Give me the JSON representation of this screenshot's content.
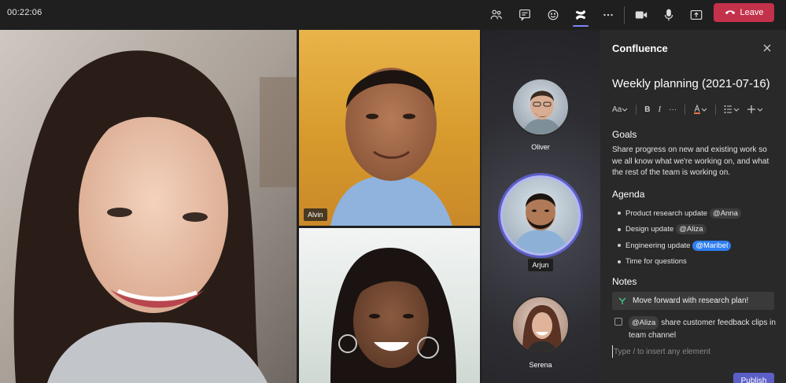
{
  "topbar": {
    "timer": "00:22:06",
    "leave_label": "Leave",
    "icons": [
      "people-icon",
      "chat-icon",
      "reactions-icon",
      "confluence-app-icon",
      "more-icon",
      "camera-icon",
      "mic-icon",
      "share-icon",
      "phone-hangup-icon"
    ],
    "leave_color": "#c4314b",
    "active_indicator_color": "#7f85f5"
  },
  "participants": {
    "alvin": "Alvin",
    "oliver": "Oliver",
    "arjun": "Arjun",
    "serena": "Serena"
  },
  "panel": {
    "title": "Confluence",
    "doc_title": "Weekly planning (2021-07-16)",
    "toolbar": {
      "font_label": "Aa",
      "bold": "B",
      "italic": "I",
      "more": "···"
    },
    "goals_heading": "Goals",
    "goals_text": "Share progress on new and existing work so we all know what we're working on, and what the rest of the team is working on.",
    "agenda_heading": "Agenda",
    "agenda": [
      {
        "text": "Product research update",
        "mention": "@Anna"
      },
      {
        "text": "Design update",
        "mention": "@Aliza"
      },
      {
        "text": "Engineering update",
        "mention": "@Maribel"
      },
      {
        "text": "Time for questions",
        "mention": ""
      }
    ],
    "notes_heading": "Notes",
    "note": "Move forward with research plan!",
    "task_mention": "@Aliza",
    "task_text": "share customer feedback clips in team channel",
    "editor_placeholder": "Type / to insert any element",
    "publish_label": "Publish",
    "accent_color": "#5b5fc7",
    "mention_highlight_color": "#2e7df2"
  }
}
